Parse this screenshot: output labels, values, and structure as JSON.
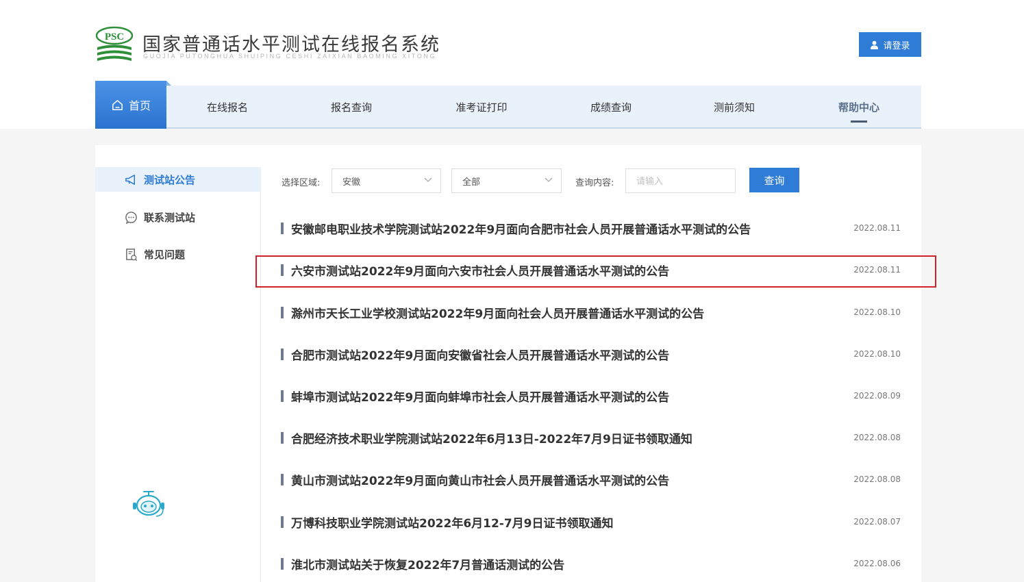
{
  "header": {
    "logo_text": "PSC",
    "title": "国家普通话水平测试在线报名系统",
    "subtitle": "GUOJIA PUTONGHUA SHUIPING CESHI ZAIXIAN BAOMING XITONG",
    "login_label": "请登录"
  },
  "nav": {
    "home_label": "首页",
    "items": [
      {
        "label": "在线报名"
      },
      {
        "label": "报名查询"
      },
      {
        "label": "准考证打印"
      },
      {
        "label": "成绩查询"
      },
      {
        "label": "测前须知"
      },
      {
        "label": "帮助中心",
        "active": true
      }
    ]
  },
  "sidebar": {
    "items": [
      {
        "label": "测试站公告",
        "icon": "megaphone-icon",
        "active": true
      },
      {
        "label": "联系测试站",
        "icon": "chat-bubble-icon"
      },
      {
        "label": "常见问题",
        "icon": "document-question-icon"
      }
    ],
    "assistant_icon": "robot-assistant-icon"
  },
  "filter": {
    "region_label": "选择区域:",
    "region_value": "安徽",
    "category_value": "全部",
    "query_label": "查询内容:",
    "query_placeholder": "请输入",
    "search_label": "查询"
  },
  "notices": [
    {
      "title": "安徽邮电职业技术学院测试站2022年9月面向合肥市社会人员开展普通话水平测试的公告",
      "date": "2022.08.11"
    },
    {
      "title": "六安市测试站2022年9月面向六安市社会人员开展普通话水平测试的公告",
      "date": "2022.08.11",
      "highlighted": true
    },
    {
      "title": "滁州市天长工业学校测试站2022年9月面向社会人员开展普通话水平测试的公告",
      "date": "2022.08.10"
    },
    {
      "title": "合肥市测试站2022年9月面向安徽省社会人员开展普通话水平测试的公告",
      "date": "2022.08.10"
    },
    {
      "title": "蚌埠市测试站2022年9月面向蚌埠市社会人员开展普通话水平测试的公告",
      "date": "2022.08.09"
    },
    {
      "title": "合肥经济技术职业学院测试站2022年6月13日-2022年7月9日证书领取通知",
      "date": "2022.08.08"
    },
    {
      "title": "黄山市测试站2022年9月面向黄山市社会人员开展普通话水平测试的公告",
      "date": "2022.08.08"
    },
    {
      "title": "万博科技职业学院测试站2022年6月12-7月9日证书领取通知",
      "date": "2022.08.07"
    },
    {
      "title": "淮北市测试站关于恢复2022年7月普通话测试的公告",
      "date": "2022.08.06"
    }
  ],
  "colors": {
    "accent": "#2e7cd6",
    "nav_bg": "#e9f1fa",
    "logo_green": "#2f8f3a",
    "highlight": "#d0222b"
  }
}
